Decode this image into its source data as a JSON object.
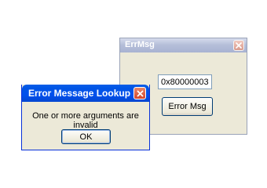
{
  "errmsg_window": {
    "title": "ErrMsg",
    "code_value": "0x80000003",
    "button_label": "Error Msg"
  },
  "lookup_dialog": {
    "title": "Error Message Lookup",
    "message": "One or more arguments are invalid",
    "ok_label": "OK"
  },
  "icons": {
    "close": "close-icon"
  },
  "colors": {
    "xp_title_blue": "#0055e5",
    "inactive_title": "#b6bfd9",
    "window_face": "#ece9d8",
    "close_red": "#d3462b"
  }
}
